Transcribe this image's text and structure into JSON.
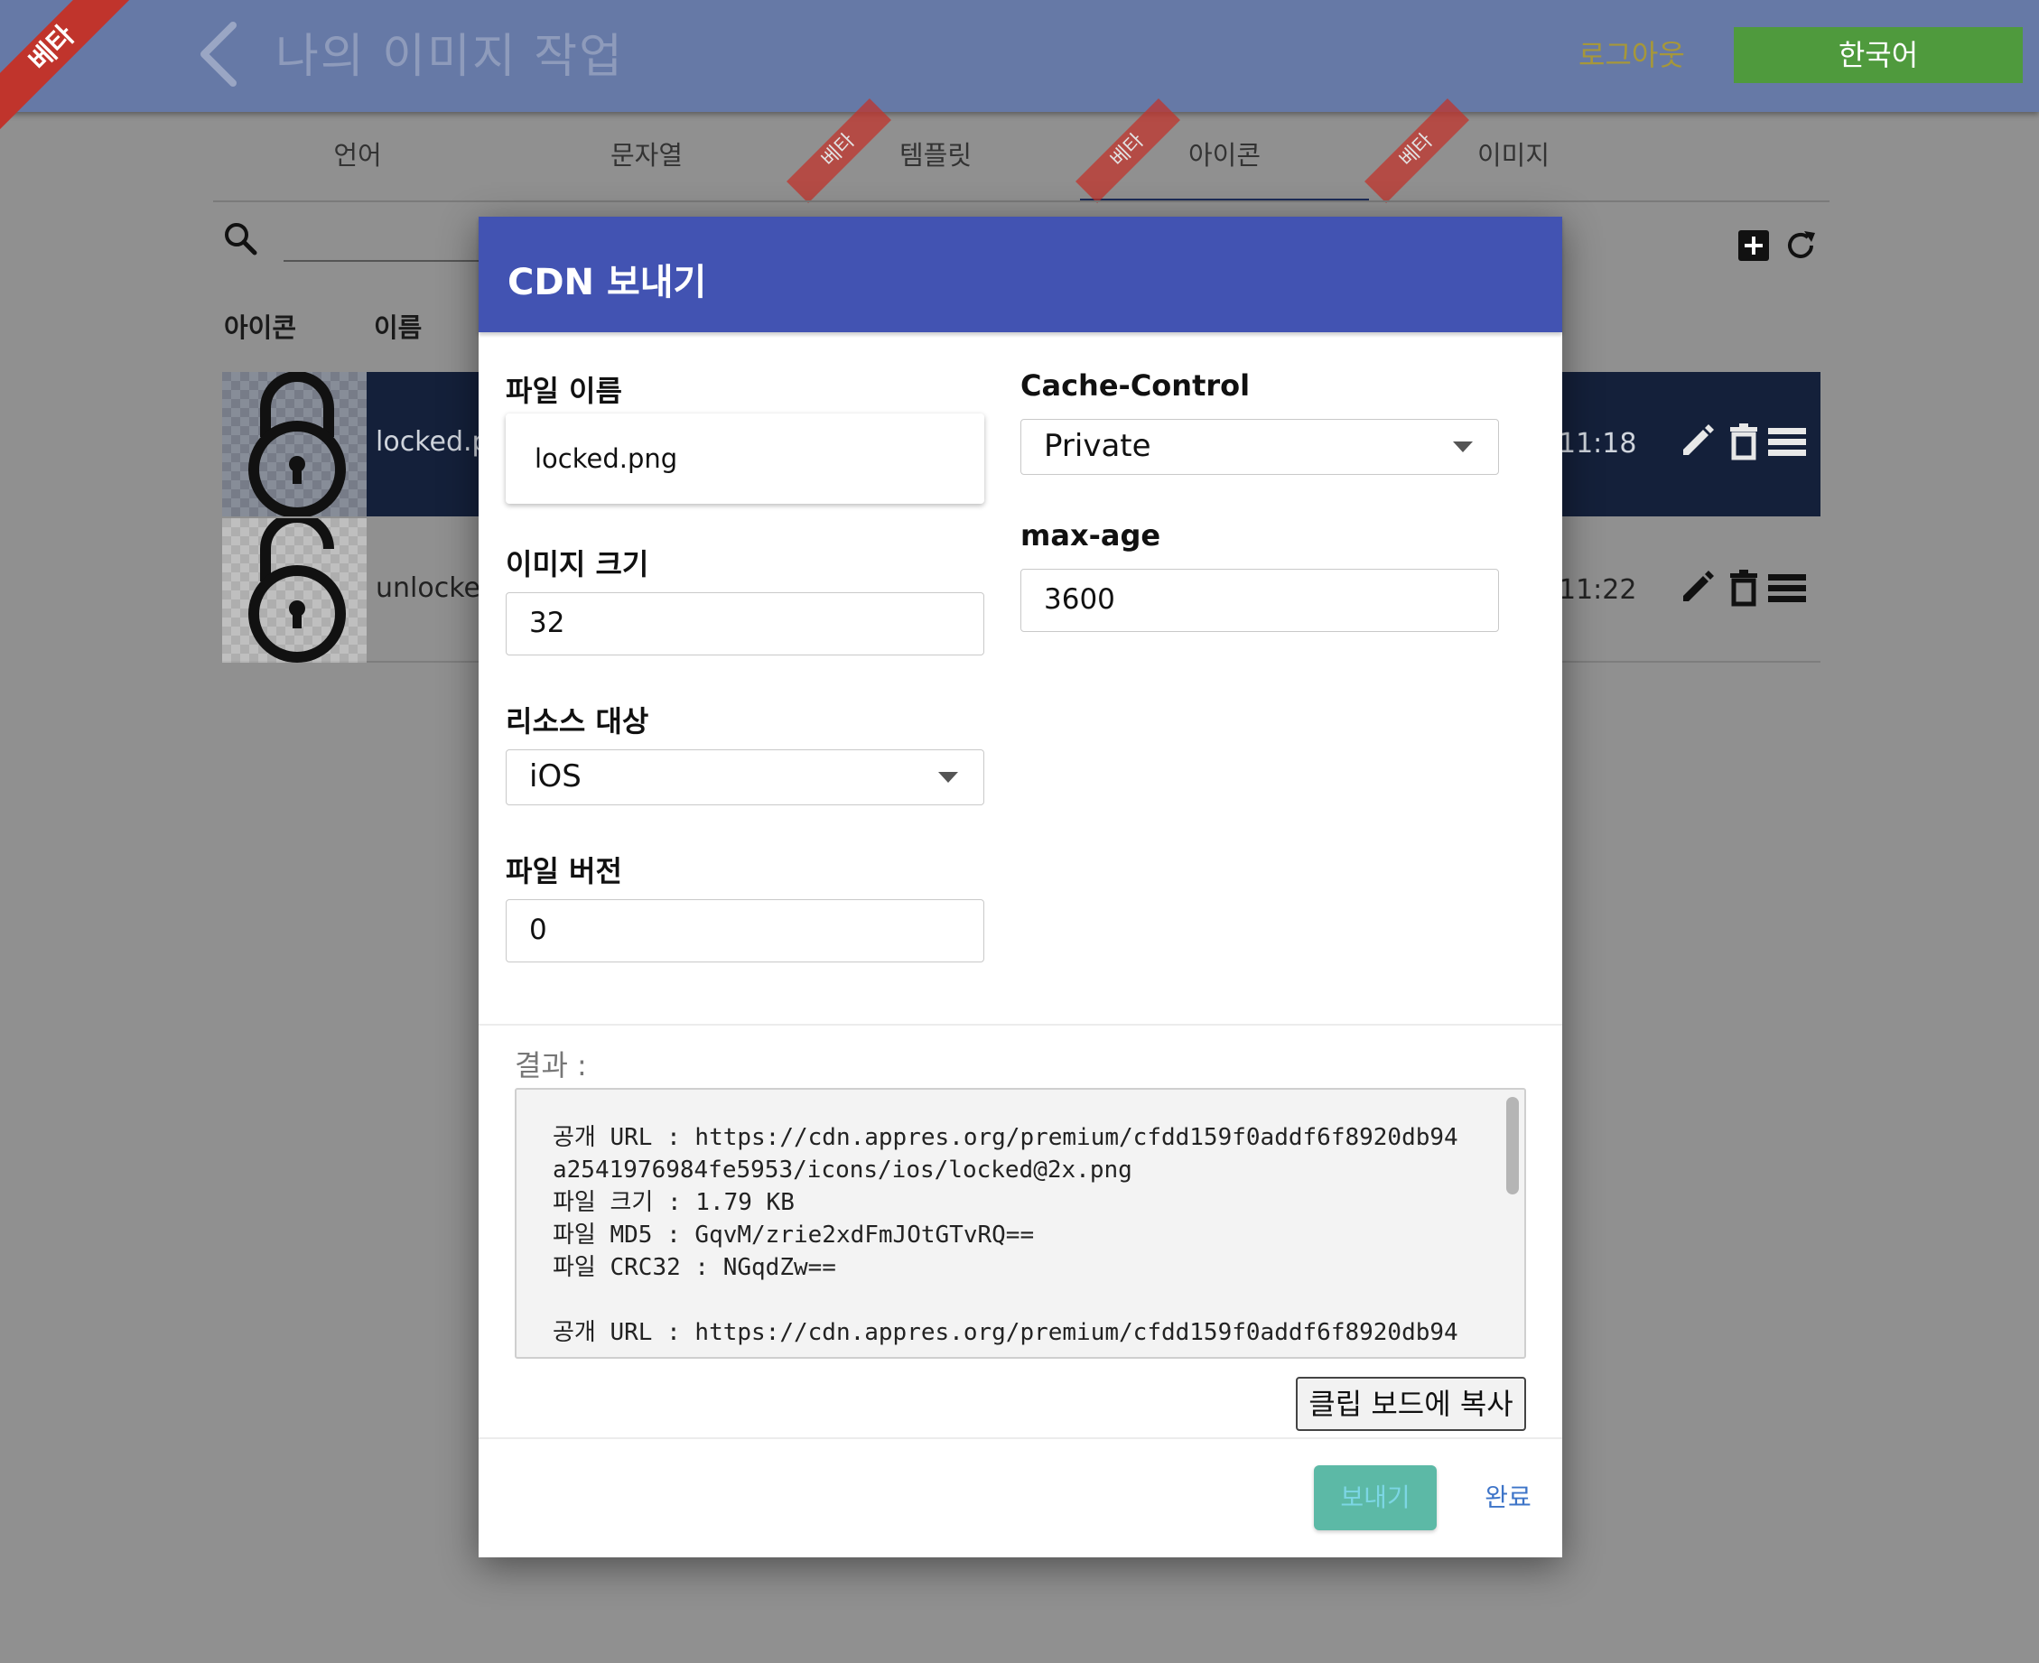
{
  "header": {
    "beta_badge": "베타",
    "title": "나의 이미지 작업",
    "logout": "로그아웃",
    "language": "한국어",
    "colors": {
      "bar": "#6679a6",
      "language_button": "#4f9a3d"
    }
  },
  "tabs": [
    {
      "label": "언어",
      "ribbon": ""
    },
    {
      "label": "문자열",
      "ribbon": ""
    },
    {
      "label": "템플릿",
      "ribbon": "베타"
    },
    {
      "label": "아이콘",
      "ribbon": "베타",
      "active": true
    },
    {
      "label": "이미지",
      "ribbon": "베타"
    }
  ],
  "list": {
    "columns": {
      "icon": "아이콘",
      "name": "이름"
    },
    "rows": [
      {
        "name": "locked.p",
        "time": "11:18",
        "icon": "lock-closed-icon",
        "selected": true
      },
      {
        "name": "unlocked",
        "time": "11:22",
        "icon": "lock-open-icon",
        "selected": false
      }
    ]
  },
  "modal": {
    "title": "CDN 보내기",
    "file_name": {
      "label": "파일 이름",
      "value": "locked.png"
    },
    "image_size": {
      "label": "이미지 크기",
      "value": "32"
    },
    "resource_target": {
      "label": "리소스 대상",
      "value": "iOS"
    },
    "file_version": {
      "label": "파일 버전",
      "value": "0"
    },
    "cache_control": {
      "label": "Cache-Control",
      "value": "Private"
    },
    "max_age": {
      "label": "max-age",
      "value": "3600"
    },
    "result_label": "결과 :",
    "result_text": "공개 URL : https://cdn.appres.org/premium/cfdd159f0addf6f8920db94\na2541976984fe5953/icons/ios/locked@2x.png\n파일 크기 : 1.79 KB\n파일 MD5 : GqvM/zrie2xdFmJOtGTvRQ==\n파일 CRC32 : NGqdZw==\n\n공개 URL : https://cdn.appres.org/premium/cfdd159f0addf6f8920db94",
    "copy_button": "클립 보드에 복사",
    "send_button": "보내기",
    "done_button": "완료",
    "colors": {
      "header": "#4253b2",
      "send": "#5cb9a6",
      "done": "#3d74c8"
    }
  }
}
